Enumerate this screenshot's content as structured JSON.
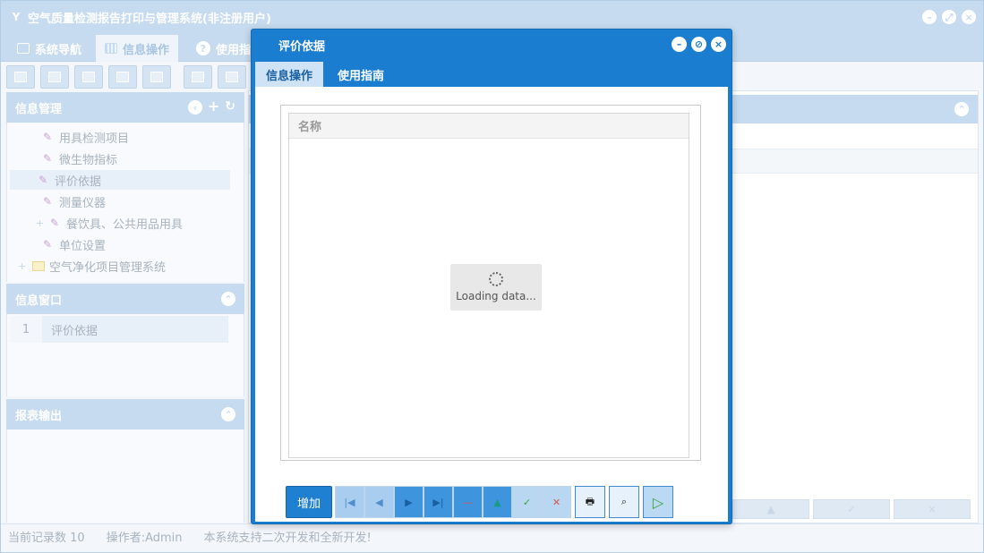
{
  "app": {
    "logo_glyph": "Y",
    "title": "空气质量检测报告打印与管理系统(非注册用户)",
    "tabs": [
      {
        "label": "系统导航"
      },
      {
        "label": "信息操作"
      },
      {
        "label": "使用指"
      }
    ]
  },
  "panels": {
    "info_management": {
      "title": "信息管理"
    },
    "info_window": {
      "title": "信息窗口"
    },
    "report_output": {
      "title": "报表输出"
    }
  },
  "tree": {
    "items": [
      {
        "label": "用具检测项目"
      },
      {
        "label": "微生物指标"
      },
      {
        "label": "评价依据"
      },
      {
        "label": "测量仪器"
      },
      {
        "label": "餐饮具、公共用品用具"
      },
      {
        "label": "单位设置"
      },
      {
        "label": "空气净化项目管理系统"
      }
    ]
  },
  "window_list": {
    "rows": [
      {
        "index": "1",
        "name": "评价依据"
      }
    ]
  },
  "status": {
    "record_count": "当前记录数 10",
    "operator": "操作者:Admin",
    "note": "本系统支持二次开发和全新开发!"
  },
  "dialog": {
    "title": "评价依据",
    "tabs": [
      {
        "label": "信息操作"
      },
      {
        "label": "使用指南"
      }
    ],
    "grid": {
      "column_header": "名称",
      "loading_text": "Loading data..."
    },
    "toolbar": {
      "add_label": "增加"
    }
  },
  "colors": {
    "dialog_blue": "#1a7dd0",
    "inactive_header": "#c6dbef"
  }
}
